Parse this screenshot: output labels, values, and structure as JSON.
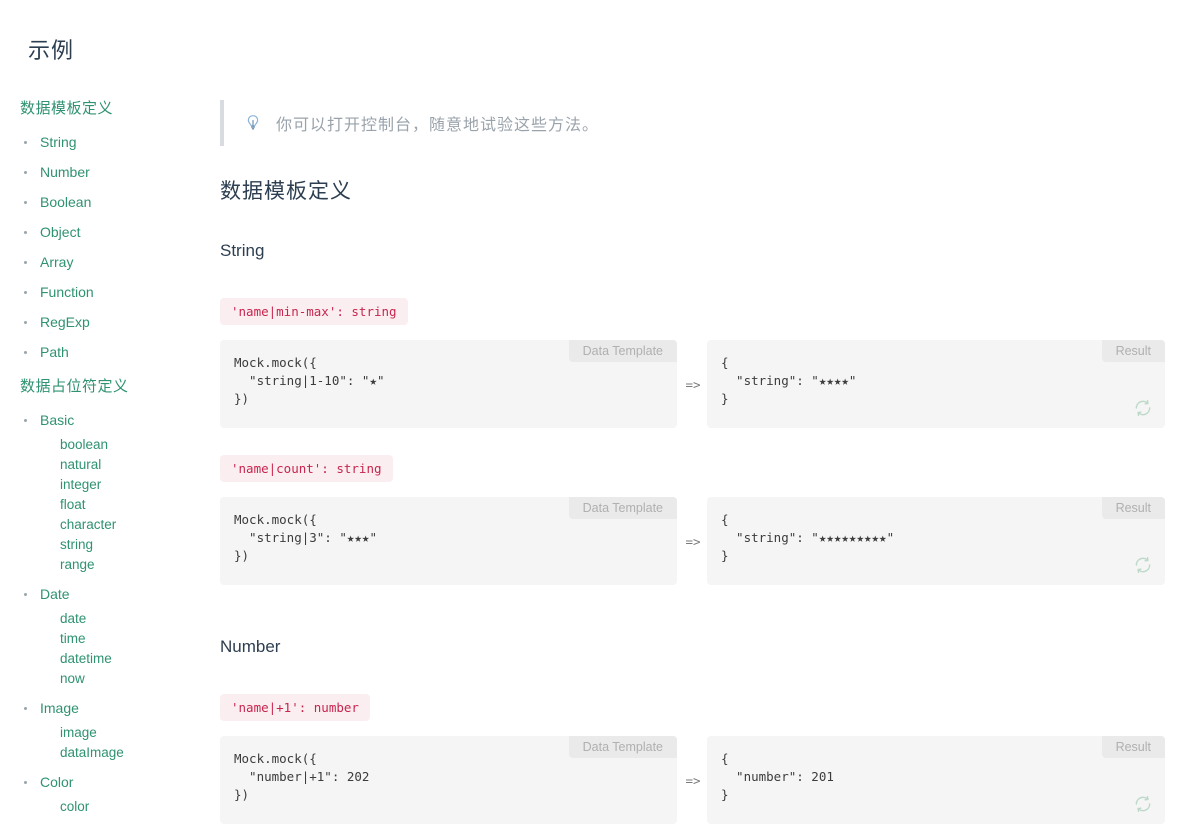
{
  "page": {
    "title": "示例"
  },
  "sidebar": {
    "groups": [
      {
        "title": "数据模板定义",
        "items": [
          {
            "label": "String",
            "children": []
          },
          {
            "label": "Number",
            "children": []
          },
          {
            "label": "Boolean",
            "children": []
          },
          {
            "label": "Object",
            "children": []
          },
          {
            "label": "Array",
            "children": []
          },
          {
            "label": "Function",
            "children": []
          },
          {
            "label": "RegExp",
            "children": []
          },
          {
            "label": "Path",
            "children": []
          }
        ]
      },
      {
        "title": "数据占位符定义",
        "items": [
          {
            "label": "Basic",
            "children": [
              "boolean",
              "natural",
              "integer",
              "float",
              "character",
              "string",
              "range"
            ]
          },
          {
            "label": "Date",
            "children": [
              "date",
              "time",
              "datetime",
              "now"
            ]
          },
          {
            "label": "Image",
            "children": [
              "image",
              "dataImage"
            ]
          },
          {
            "label": "Color",
            "children": [
              "color"
            ]
          }
        ]
      }
    ]
  },
  "tip": {
    "icon": "lightbulb-icon",
    "text": "你可以打开控制台，随意地试验这些方法。"
  },
  "main": {
    "section_heading": "数据模板定义",
    "subsections": [
      {
        "heading": "String"
      },
      {
        "heading": "Number"
      }
    ],
    "labels": {
      "data_template": "Data Template",
      "result": "Result",
      "arrow": "=>",
      "refresh_icon": "refresh-icon"
    },
    "examples": [
      {
        "pill": "'name|min-max': string",
        "template_code": "Mock.mock({\n  \"string|1-10\": \"★\"\n})",
        "result_code": "{\n  \"string\": \"★★★★\"\n}"
      },
      {
        "pill": "'name|count': string",
        "template_code": "Mock.mock({\n  \"string|3\": \"★★★\"\n})",
        "result_code": "{\n  \"string\": \"★★★★★★★★★\"\n}"
      },
      {
        "pill": "'name|+1': number",
        "template_code": "Mock.mock({\n  \"number|+1\": 202\n})",
        "result_code": "{\n  \"number\": 201\n}"
      }
    ]
  },
  "colors": {
    "sidebar_link": "#2f9272",
    "heading": "#2c3e50",
    "pill_bg": "#fbeef0",
    "pill_text": "#c7254e",
    "panel_bg": "#f5f5f5",
    "tab_bg": "#eaeaea",
    "tab_text": "#b0b0b0",
    "tip_text": "#9aa3ab",
    "refresh": "#bcd9c9"
  }
}
